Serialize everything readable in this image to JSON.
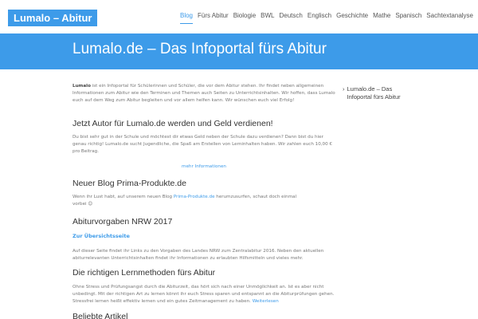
{
  "header": {
    "logo": "Lumalo – Abitur",
    "nav": [
      "Blog",
      "Fürs Abitur",
      "Biologie",
      "BWL",
      "Deutsch",
      "Englisch",
      "Geschichte",
      "Mathe",
      "Spanisch",
      "Sachtextanalyse"
    ],
    "active": "Blog"
  },
  "hero": {
    "title": "Lumalo.de – Das Infoportal fürs Abitur"
  },
  "intro": {
    "brand": "Lumalo",
    "text": " ist ein Infoportal für Schülerinnen und Schüler, die vor dem Abitur stehen. Ihr findet neben allgemeinen Informationen zum Abitur wie den Terminen und Themen auch Seiten zu Unterrichtsinhalten. Wir hoffen, dass Lumalo euch auf dem Weg zum Abitur begleiten und vor allem helfen kann. Wir wünschen euch viel Erfolg!"
  },
  "sections": {
    "author": {
      "heading": "Jetzt Autor für Lumalo.de werden und Geld verdienen!",
      "text": "Du bist sehr gut in der Schule und möchtest dir etwas Geld neben der Schule dazu verdienen? Dann bist du hier genau richtig! Lumalo.de sucht Jugendliche, die Spaß am Erstellen von Lerninhalten haben. Wir zahlen euch 10,00 € pro Beitrag.",
      "more": "mehr Informationen"
    },
    "blog": {
      "heading": "Neuer Blog Prima-Produkte.de",
      "text_before": "Wenn ihr Lust habt, auf unserem neuen Blog ",
      "link": "Prima-Produkte.de",
      "text_after": " herumzusurfen, schaut doch einmal vorbei ",
      "emoji": "😊"
    },
    "nrw": {
      "heading": "Abiturvorgaben NRW 2017",
      "link": "Zur Übersichtsseite",
      "text": "Auf dieser Seite findet ihr Links zu den Vorgaben des Landes NRW zum Zentralabitur 2016.  Neben den aktuellen abiturrelevanten Unterrichtsinhalten findet ihr Informationen zu erlaubten Hilfsmitteln und vieles mehr."
    },
    "learning": {
      "heading": "Die richtigen Lernmethoden fürs Abitur",
      "text": "Ohne Stress und Prüfungsangst durch die Abiturzeit, das hört sich nach einer Unmöglichkeit an. Ist es aber nicht unbedingt. Mit der richtigen Art zu lernen könnt ihr euch Stress sparen und entspannt an die Abiturprüfungen gehen. Stressfrei lernen heißt effektiv lernen und ein gutes Zeitmanagement zu haben. ",
      "link": "Weiterlesen"
    },
    "cut_heading": "Beliebte Artikel"
  },
  "sidebar": {
    "items": [
      {
        "chevron": "›",
        "label": "Lumalo.de – Das Infoportal fürs Abitur"
      }
    ]
  },
  "colors": {
    "accent": "#3d9be9",
    "heading": "#333333",
    "text": "#777777"
  }
}
